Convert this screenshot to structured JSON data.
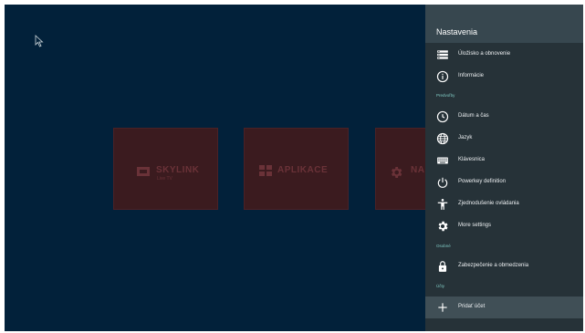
{
  "tiles": [
    {
      "name": "skylink",
      "label": "SKYLINK",
      "sub": "Live TV"
    },
    {
      "name": "aplikace",
      "label": "APLIKACE"
    },
    {
      "name": "nastaveni",
      "label": "NA"
    }
  ],
  "panel": {
    "title": "Nastavenia",
    "items_top": [
      {
        "label": "Úložisko a obnovenie",
        "icon": "storage-icon"
      },
      {
        "label": "Informácie",
        "icon": "info-icon"
      }
    ],
    "section_preferences": "Predvoľby",
    "items_preferences": [
      {
        "label": "Dátum a čas",
        "icon": "clock-icon"
      },
      {
        "label": "Jazyk",
        "icon": "globe-icon"
      },
      {
        "label": "Klávesnica",
        "icon": "keyboard-icon"
      },
      {
        "label": "Powerkey definition",
        "icon": "power-icon"
      },
      {
        "label": "Zjednodušenie ovládania",
        "icon": "accessibility-icon"
      },
      {
        "label": "More settings",
        "icon": "gear-icon"
      }
    ],
    "section_personal": "Osobné",
    "items_personal": [
      {
        "label": "Zabezpečenie a obmedzenia",
        "icon": "lock-icon"
      }
    ],
    "section_accounts": "Účty",
    "items_accounts": [
      {
        "label": "Pridať účet",
        "icon": "plus-icon"
      }
    ]
  }
}
